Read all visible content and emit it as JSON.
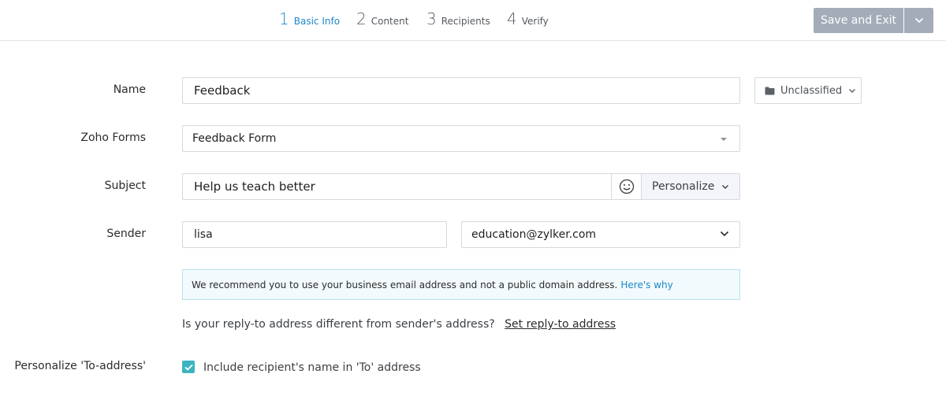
{
  "header": {
    "steps": [
      {
        "num": "1",
        "label": "Basic Info",
        "active": true
      },
      {
        "num": "2",
        "label": "Content",
        "active": false
      },
      {
        "num": "3",
        "label": "Recipients",
        "active": false
      },
      {
        "num": "4",
        "label": "Verify",
        "active": false
      }
    ],
    "save_label": "Save and Exit"
  },
  "form": {
    "name": {
      "label": "Name",
      "value": "Feedback"
    },
    "folder": {
      "icon": "folder-icon",
      "value": "Unclassified"
    },
    "zoho_forms": {
      "label": "Zoho Forms",
      "value": "Feedback Form"
    },
    "subject": {
      "label": "Subject",
      "value": "Help us teach better",
      "emoji_icon": "smiley-icon",
      "personalize_label": "Personalize"
    },
    "sender": {
      "label": "Sender",
      "name_value": "lisa",
      "email_value": "education@zylker.com"
    },
    "notice": {
      "text": "We recommend you to use your business email address and not a public domain address.",
      "link": "Here's why"
    },
    "reply_to": {
      "text": "Is your reply-to address different from sender's address?",
      "link": "Set reply-to address"
    },
    "personalize_to": {
      "label": "Personalize 'To-address'",
      "checkbox_label": "Include recipient's name in 'To' address",
      "checked": true
    }
  },
  "colors": {
    "accent": "#1b87c9",
    "button_disabled": "#a3acb8",
    "checkbox": "#3bb4c1",
    "notice_border": "#b7e3ec"
  }
}
